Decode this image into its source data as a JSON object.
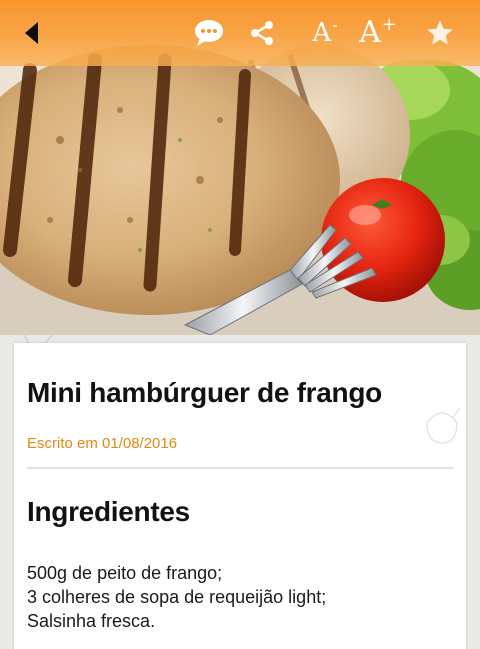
{
  "toolbar": {
    "back_icon": "back-arrow-icon",
    "comment_icon": "comment-bubble-icon",
    "share_icon": "share-icon",
    "font_decrease_label": "A",
    "font_decrease_sign": "-",
    "font_increase_label": "A",
    "font_increase_sign": "+",
    "favorite_icon": "star-icon",
    "background_color": "#f8942a",
    "icon_color": "#ffffff"
  },
  "hero": {
    "image_content": "grilled chicken burger patty with tomato, lettuce and fork"
  },
  "recipe": {
    "title": "Mini hambúrguer de frango",
    "meta": "Escrito em 01/08/2016",
    "meta_color": "#e08a14",
    "section_title": "Ingredientes",
    "ingredients": [
      "500g de peito de frango;",
      "3 colheres de sopa de requeijão light;",
      "Salsinha fresca."
    ]
  }
}
